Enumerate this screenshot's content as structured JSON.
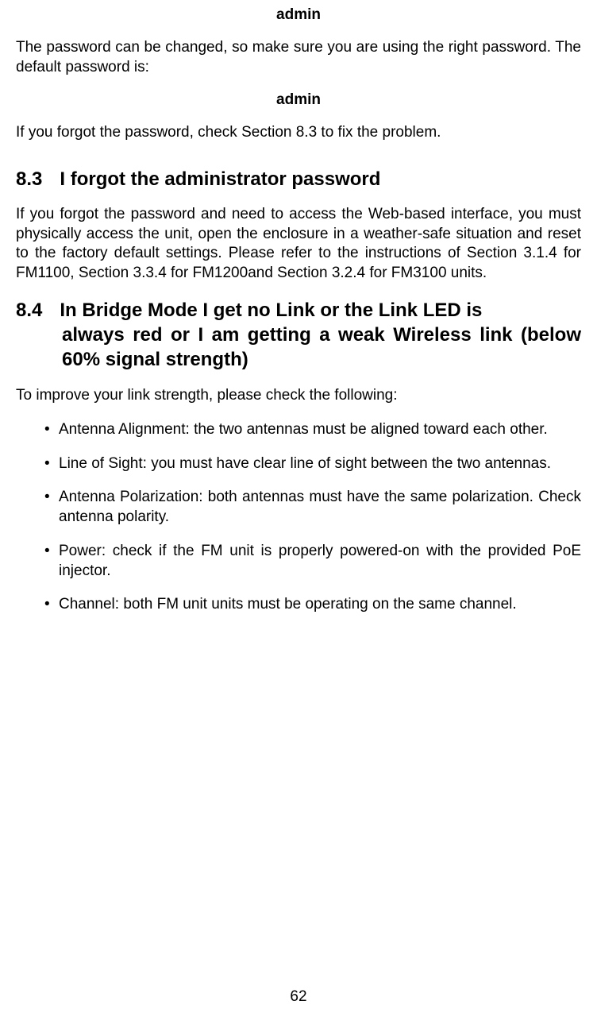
{
  "adminLabel1": "admin",
  "passwordChangeText": "The password can be changed, so make sure you are using the right password. The default password is:",
  "adminLabel2": "admin",
  "forgotPasswordRef": "If you forgot the password, check Section 8.3 to fix the problem.",
  "section83": {
    "number": "8.3",
    "title": "I forgot the administrator password",
    "body": "If you forgot the password and need to access the Web-based interface, you must physically access the unit, open the enclosure in a weather-safe situation and reset to the factory default settings.  Please refer to the instructions of Section 3.1.4 for FM1100, Section 3.3.4 for FM1200and Section 3.2.4 for FM3100 units."
  },
  "section84": {
    "number": "8.4",
    "titleLine1": "In Bridge Mode I get no Link or the Link LED is",
    "titleLine2": "always red or I am getting a weak Wireless link (below 60% signal strength)",
    "intro": "To improve your link strength, please check the following:",
    "items": [
      "Antenna Alignment:    the two antennas must be aligned toward each other.",
      "Line of Sight:   you must have clear line of sight between the two antennas.",
      "Antenna Polarization:    both antennas must have the same polarization. Check antenna polarity.",
      "Power:  check if the FM unit is properly powered-on with the provided PoE injector.",
      "Channel:  both FM unit units must be operating on the same channel."
    ]
  },
  "pageNumber": "62"
}
